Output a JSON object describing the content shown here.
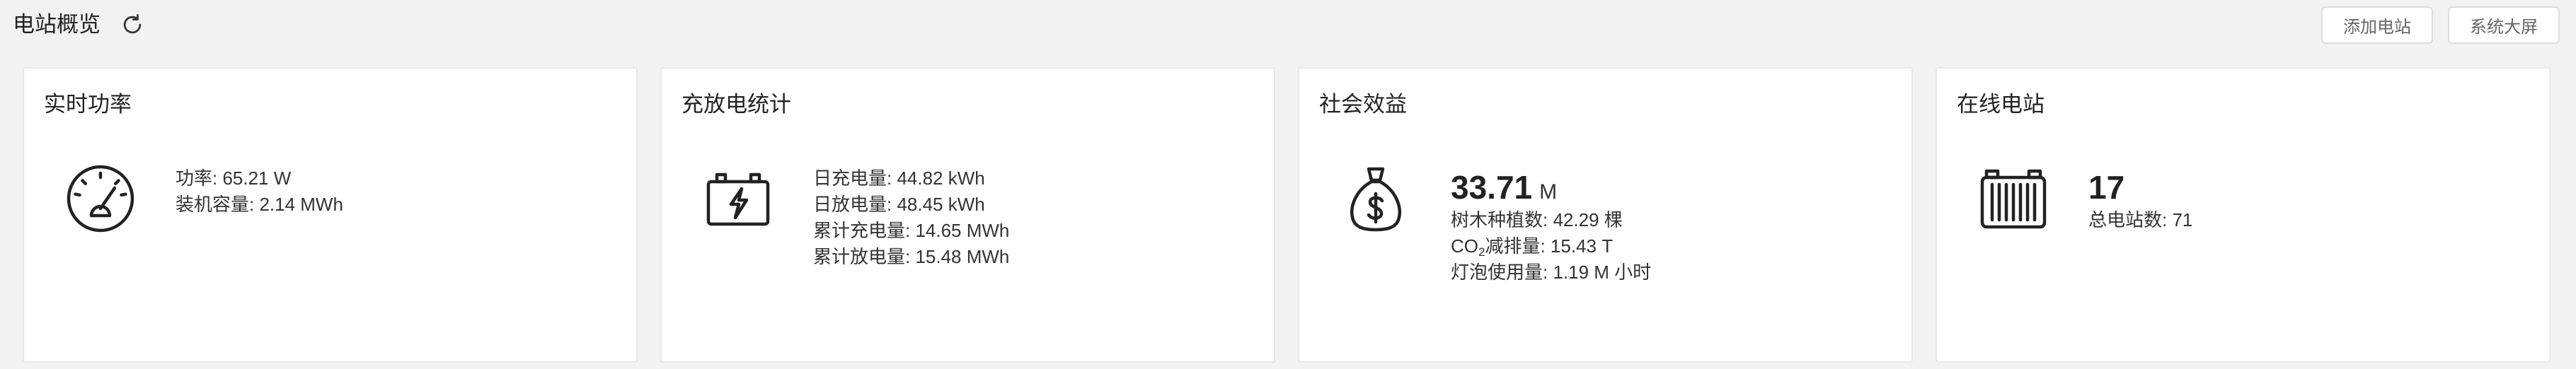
{
  "header": {
    "title": "电站概览",
    "refresh_icon": "refresh-icon",
    "buttons": [
      {
        "label": "添加电站"
      },
      {
        "label": "系统大屏"
      }
    ]
  },
  "cards": {
    "realtime_power": {
      "title": "实时功率",
      "icon": "speedometer-icon",
      "lines": [
        "功率: 65.21 W",
        "装机容量: 2.14 MWh"
      ]
    },
    "charge_stats": {
      "title": "充放电统计",
      "icon": "battery-charge-icon",
      "lines": [
        "日充电量: 44.82 kWh",
        "日放电量: 48.45 kWh",
        "累计充电量: 14.65 MWh",
        "累计放电量: 15.48 MWh"
      ]
    },
    "social_benefit": {
      "title": "社会效益",
      "icon": "money-bag-icon",
      "value": "33.71",
      "unit": "M",
      "trees": "树木种植数: 42.29 棵",
      "co2": {
        "prefix": "CO",
        "sub": "2",
        "suffix": "减排量: 15.43 T"
      },
      "bulbs": "灯泡使用量: 1.19 M 小时"
    },
    "online_stations": {
      "title": "在线电站",
      "icon": "battery-pack-icon",
      "value": "17",
      "total": "总电站数: 71"
    }
  },
  "colors": {
    "page_background": "#f2f2f2",
    "card_background": "#ffffff",
    "card_border": "#e8e8e8",
    "text_primary": "#222222",
    "text_secondary": "#333333",
    "button_text": "#666666",
    "button_border": "#dcdcdc"
  }
}
